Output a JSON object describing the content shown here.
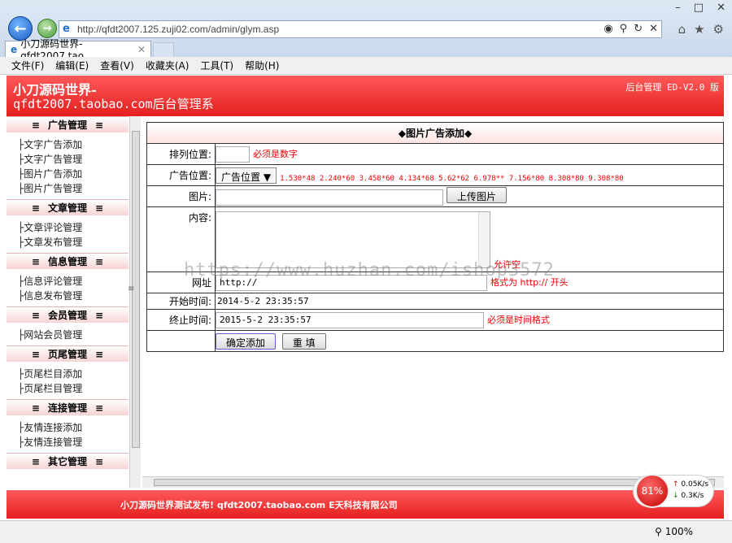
{
  "browser": {
    "url": "http://qfdt2007.125.zuji02.com/admin/glym.asp",
    "tab_title": "小刀源码世界-qfdt2007.tao...",
    "menu": [
      "文件(F)",
      "编辑(E)",
      "查看(V)",
      "收藏夹(A)",
      "工具(T)",
      "帮助(H)"
    ],
    "zoom": "100%"
  },
  "banner": {
    "line1": "小刀源码世界-",
    "line2": "qfdt2007.taobao.com后台管理系",
    "version": "后台管理 ED-V2.0 版"
  },
  "sidebar": [
    {
      "title": "广告管理",
      "items": [
        "文字广告添加",
        "文字广告管理",
        "图片广告添加",
        "图片广告管理"
      ]
    },
    {
      "title": "文章管理",
      "items": [
        "文章评论管理",
        "文章发布管理"
      ]
    },
    {
      "title": "信息管理",
      "items": [
        "信息评论管理",
        "信息发布管理"
      ]
    },
    {
      "title": "会员管理",
      "items": [
        "网站会员管理"
      ]
    },
    {
      "title": "页尾管理",
      "items": [
        "页尾栏目添加",
        "页尾栏目管理"
      ]
    },
    {
      "title": "连接管理",
      "items": [
        "友情连接添加",
        "友情连接管理"
      ]
    },
    {
      "title": "其它管理",
      "items": []
    }
  ],
  "form": {
    "title": "◆图片广告添加◆",
    "order_label": "排列位置:",
    "order_hint": "必须是数字",
    "pos_label": "广告位置:",
    "pos_value": "广告位置",
    "pos_hint": "1.530*48 2.240*60 3.458*60 4.134*68 5.62*62 6.978** 7.156*80 8.308*80 9.308*80",
    "img_label": "图片:",
    "upload_label": "上传图片",
    "content_label": "内容:",
    "content_hint": "允许空",
    "url_label": "网址",
    "url_value": "http://",
    "url_hint": "格式为 http:// 开头",
    "start_label": "开始时间:",
    "start_value": "2014-5-2 23:35:57",
    "end_label": "终止时间:",
    "end_value": "2015-5-2 23:35:57",
    "end_hint": "必须是时间格式",
    "submit_label": "确定添加",
    "reset_label": "重 填"
  },
  "footer": "小刀源码世界测试发布! qfdt2007.taobao.com E天科技有限公司",
  "watermark": "https://www.huzhan.com/ishop3572",
  "net": {
    "percent": "81%",
    "up": "0.05K/s",
    "down": "0.3K/s"
  }
}
